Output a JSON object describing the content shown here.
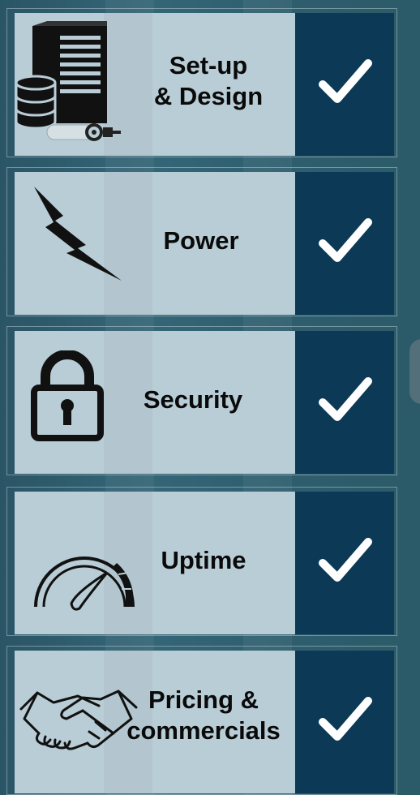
{
  "items": [
    {
      "label_line1": "Set-up",
      "label_line2": "& Design",
      "icon": "server-database-icon"
    },
    {
      "label_line1": "Power",
      "icon": "lightning-bolt-icon"
    },
    {
      "label_line1": "Security",
      "icon": "padlock-icon"
    },
    {
      "label_line1": "Uptime",
      "icon": "speedometer-gauge-icon"
    },
    {
      "label_line1": "Pricing &",
      "label_line2": "commercials",
      "icon": "handshake-icon"
    }
  ],
  "colors": {
    "background": "#2e5e6e",
    "card": "#b9cdd6",
    "check_panel": "#0b3956",
    "check": "#ffffff"
  }
}
